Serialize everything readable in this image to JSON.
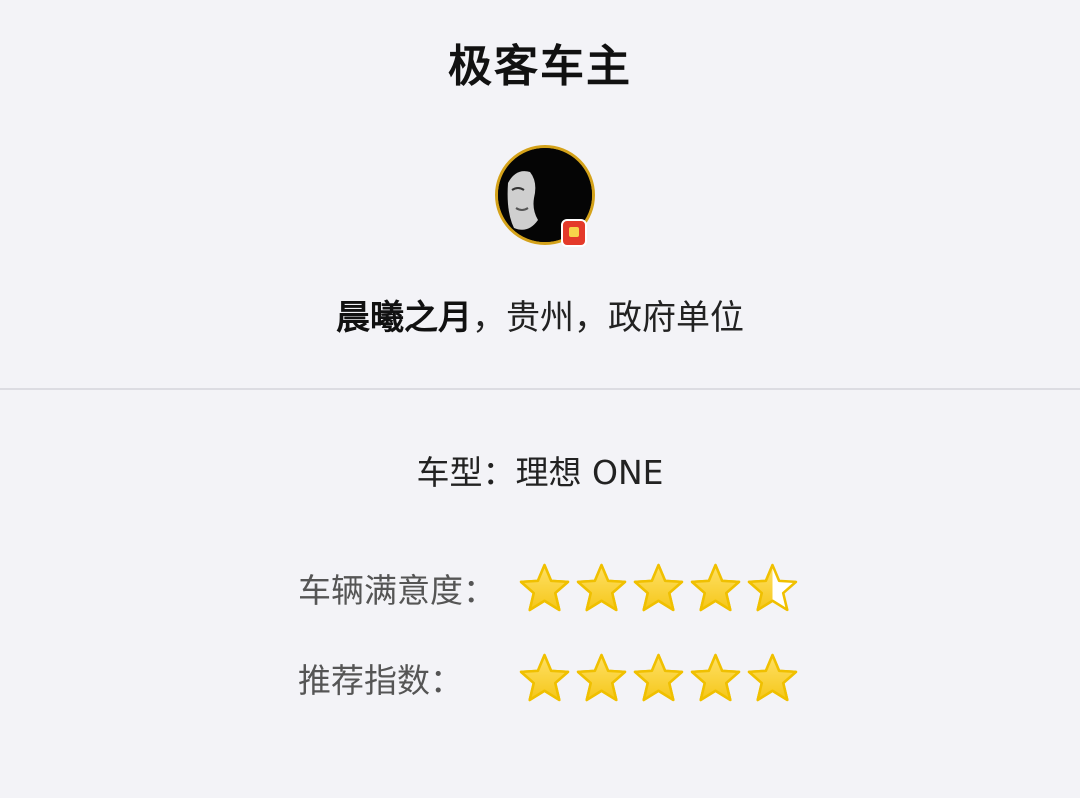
{
  "header": {
    "title": "极客车主"
  },
  "profile": {
    "avatar_icon": "avatar-photo",
    "badge_icon": "certified-badge-icon",
    "name": "晨曦之月",
    "sep1": "，",
    "location": "贵州",
    "sep2": "，",
    "occupation": "政府单位"
  },
  "vehicle": {
    "model_label": "车型：",
    "model_value": "理想 ONE"
  },
  "ratings": [
    {
      "label": "车辆满意度：",
      "value": 4.5,
      "max": 5
    },
    {
      "label": "推荐指数：",
      "value": 5,
      "max": 5
    }
  ],
  "colors": {
    "star_fill": "#f5c71a",
    "star_outline": "#f0c000",
    "avatar_border": "#d4a21a",
    "divider": "#dcdce2"
  }
}
